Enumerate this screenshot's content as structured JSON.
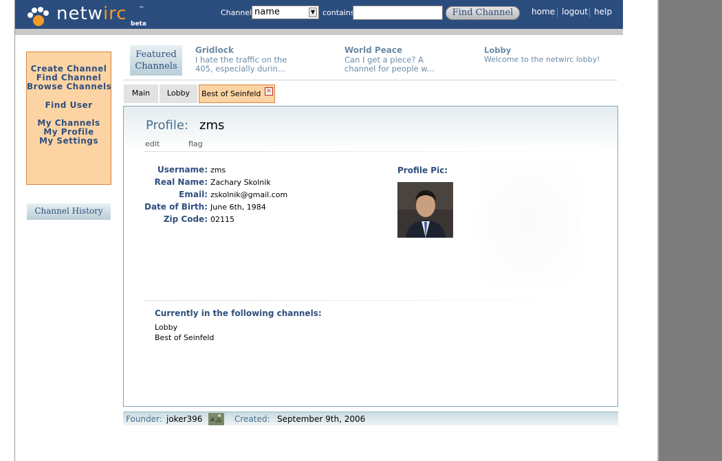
{
  "brand": {
    "logo_net": "netw",
    "logo_irc": "irc",
    "trademark": "™",
    "beta": "beta"
  },
  "header": {
    "channel_label": "Channel",
    "channel_field_selected": "name",
    "contains_label": "contains",
    "search_value": "",
    "find_button": "Find Channel",
    "nav": [
      "home",
      "logout",
      "help"
    ]
  },
  "sidebar": {
    "links": [
      "Create Channel",
      "Find Channel",
      "Browse Channels",
      "Find User",
      "My Channels",
      "My Profile",
      "My Settings"
    ],
    "history_tab": "Channel History"
  },
  "featured": {
    "tab_line1": "Featured",
    "tab_line2": "Channels",
    "channels": [
      {
        "title": "Gridlock",
        "desc_line1": "I hate the traffic on the",
        "desc_line2": "405, especially durin..."
      },
      {
        "title": "World Peace",
        "desc_line1": "Can I get a piece?  A",
        "desc_line2": "channel for people w..."
      },
      {
        "title": "Lobby",
        "desc_line1": "Welcome to the netwirc lobby!",
        "desc_line2": ""
      }
    ]
  },
  "tabs": [
    {
      "label": "Main",
      "active": false
    },
    {
      "label": "Lobby",
      "active": false
    },
    {
      "label": "Best of Seinfeld",
      "active": true
    }
  ],
  "tab_close_glyph": "×",
  "profile": {
    "heading_label": "Profile:",
    "username": "zms",
    "actions": [
      "edit",
      "flag"
    ],
    "fields": [
      {
        "label": "Username:",
        "value": "zms"
      },
      {
        "label": "Real Name:",
        "value": "Zachary Skolnik"
      },
      {
        "label": "Email:",
        "value": "zskolnik@gmail.com"
      },
      {
        "label": "Date of Birth:",
        "value": "June 6th, 1984"
      },
      {
        "label": "Zip Code:",
        "value": "02115"
      }
    ],
    "pic_label": "Profile Pic:",
    "channels_heading": "Currently in the following channels:",
    "channels": [
      "Lobby",
      "Best of Seinfeld"
    ]
  },
  "footer": {
    "founder_label": "Founder:",
    "founder": "joker396",
    "created_label": "Created:",
    "created": "September 9th, 2006"
  },
  "colors": {
    "header_bg": "#2b4d7e",
    "accent_orange": "#f39a27",
    "sidebar_bg": "#fcd4a4",
    "link_blue": "#2f4e7e"
  },
  "icons": {
    "logo": "paw-print-icon",
    "tab_close": "close-icon",
    "select_arrow": "chevron-down-icon"
  }
}
